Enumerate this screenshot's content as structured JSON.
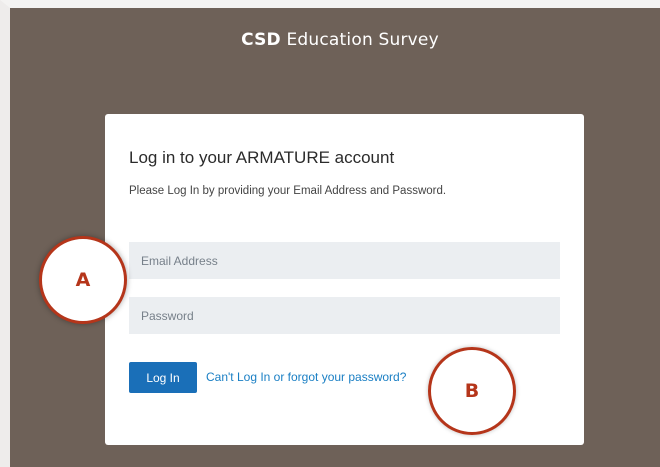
{
  "header": {
    "title_bold": "CSD",
    "title_rest": " Education Survey"
  },
  "login_card": {
    "heading": "Log in to your ARMATURE account",
    "subtext": "Please Log In by providing your Email Address and Password.",
    "email_placeholder": "Email Address",
    "email_value": "",
    "password_placeholder": "Password",
    "password_value": "",
    "login_button": "Log In",
    "forgot_link": "Can't Log In or forgot your password?"
  },
  "annotations": {
    "marker_a": "A",
    "marker_b": "B"
  },
  "colors": {
    "background": "#6e6158",
    "primary_button": "#1a6fb8",
    "link": "#1a7fc4",
    "annotation": "#b5351a"
  }
}
